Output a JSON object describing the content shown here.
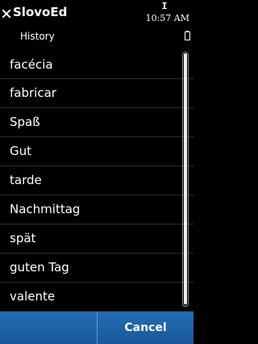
{
  "header": {
    "app_title": "SlovoEd",
    "subtitle": "History",
    "time": "10:57 AM"
  },
  "icons": {
    "close": "close-icon",
    "signal": "signal-icon",
    "battery": "battery-icon"
  },
  "history": {
    "items": [
      "facécia",
      "fabricar",
      "Spaß",
      "Gut",
      "tarde",
      "Nachmittag",
      "spät",
      "guten Tag",
      "valente"
    ]
  },
  "softkeys": {
    "left_label": "",
    "right_label": "Cancel"
  },
  "colors": {
    "background": "#000000",
    "softkey_bar": "#1f63a8",
    "text": "#ffffff"
  }
}
